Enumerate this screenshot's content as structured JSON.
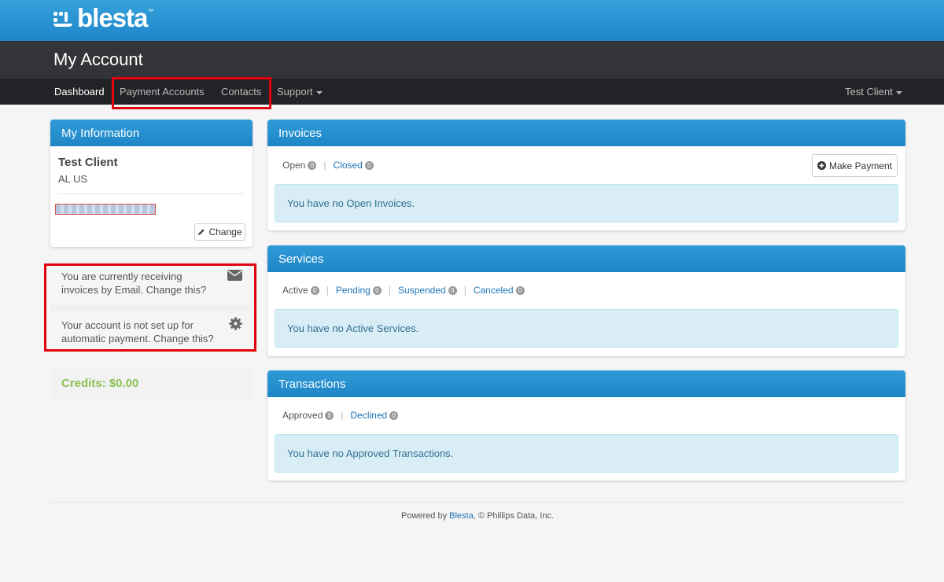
{
  "brand": {
    "logo_text": "blesta",
    "logo_tm": "™"
  },
  "page_title": "My Account",
  "nav": {
    "dashboard": "Dashboard",
    "payment_accounts": "Payment Accounts",
    "contacts": "Contacts",
    "support": "Support",
    "user_menu": "Test Client"
  },
  "my_information": {
    "heading": "My Information",
    "name": "Test Client",
    "location": "AL US",
    "change_label": "Change"
  },
  "notices": {
    "invoice_method": "You are currently receiving invoices by Email. Change this?",
    "autopay": "Your account is not set up for automatic payment. Change this?"
  },
  "credits": "Credits: $0.00",
  "invoices": {
    "heading": "Invoices",
    "filters": [
      {
        "label": "Open",
        "count": "0"
      },
      {
        "label": "Closed",
        "count": "0"
      }
    ],
    "make_payment_label": "Make Payment",
    "empty_message": "You have no Open Invoices."
  },
  "services": {
    "heading": "Services",
    "filters": [
      {
        "label": "Active",
        "count": "0"
      },
      {
        "label": "Pending",
        "count": "0"
      },
      {
        "label": "Suspended",
        "count": "0"
      },
      {
        "label": "Canceled",
        "count": "0"
      }
    ],
    "empty_message": "You have no Active Services."
  },
  "transactions": {
    "heading": "Transactions",
    "filters": [
      {
        "label": "Approved",
        "count": "0"
      },
      {
        "label": "Declined",
        "count": "0"
      }
    ],
    "empty_message": "You have no Approved Transactions."
  },
  "footer": {
    "prefix": "Powered by ",
    "link": "Blesta",
    "suffix": ", © Phillips Data, Inc."
  },
  "colors": {
    "header_blue": "#2a96d6",
    "nav_dark": "#222326",
    "highlight_red": "#e3000f",
    "credits_green": "#8cc152",
    "link_blue": "#1f76b8"
  }
}
